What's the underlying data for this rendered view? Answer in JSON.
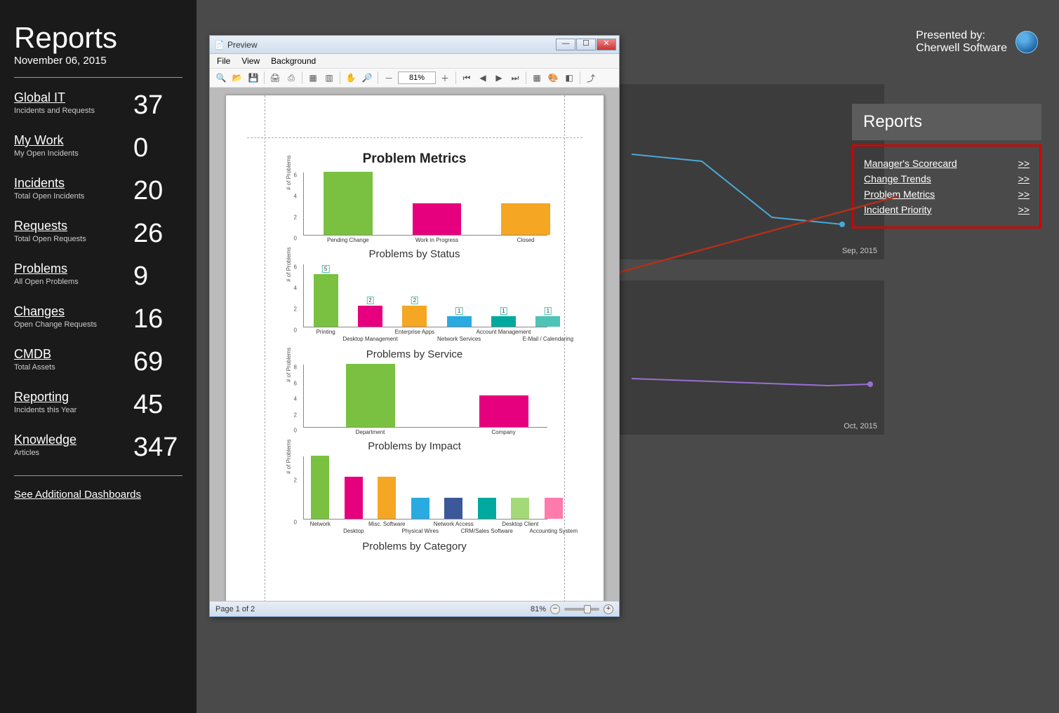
{
  "sidebar": {
    "title": "Reports",
    "date": "November 06, 2015",
    "items": [
      {
        "label": "Global IT",
        "sub": "Incidents and Requests",
        "value": "37"
      },
      {
        "label": "My Work",
        "sub": "My Open Incidents",
        "value": "0"
      },
      {
        "label": "Incidents",
        "sub": "Total Open Incidents",
        "value": "20"
      },
      {
        "label": "Requests",
        "sub": "Total Open Requests",
        "value": "26"
      },
      {
        "label": "Problems",
        "sub": "All Open Problems",
        "value": "9"
      },
      {
        "label": "Changes",
        "sub": "Open Change Requests",
        "value": "16"
      },
      {
        "label": "CMDB",
        "sub": "Total Assets",
        "value": "69"
      },
      {
        "label": "Reporting",
        "sub": "Incidents this Year",
        "value": "45"
      },
      {
        "label": "Knowledge",
        "sub": "Articles",
        "value": "347"
      }
    ],
    "additional": "See Additional Dashboards"
  },
  "presented": {
    "small": "Presented by:",
    "brand": "Cherwell Software"
  },
  "reports_panel": {
    "header": "Reports",
    "links": [
      {
        "label": "Manager's Scorecard",
        "arrow": ">>"
      },
      {
        "label": "Change Trends",
        "arrow": ">>"
      },
      {
        "label": "Problem Metrics",
        "arrow": ">>"
      },
      {
        "label": "Incident Priority",
        "arrow": ">>"
      }
    ]
  },
  "bg_dates": {
    "top": "Sep, 2015",
    "bottom": "Oct, 2015"
  },
  "preview": {
    "title": "Preview",
    "menu": {
      "file": "File",
      "view": "View",
      "background": "Background"
    },
    "zoom_toolbar": "81%",
    "status_page": "Page 1 of 2",
    "status_zoom": "81%",
    "report_title": "Problem Metrics",
    "ylabel": "# of Problems",
    "charts": {
      "status": "Problems by Status",
      "service": "Problems by Service",
      "impact": "Problems by Impact",
      "category": "Problems by Category"
    }
  },
  "chart_data": [
    {
      "type": "bar",
      "title": "Problems by Status",
      "ylabel": "# of Problems",
      "ylim": [
        0,
        6
      ],
      "categories": [
        "Pending Change",
        "Work in Progress",
        "Closed"
      ],
      "values": [
        6,
        3,
        3
      ],
      "colors": [
        "#7ac142",
        "#e6007e",
        "#f5a623"
      ]
    },
    {
      "type": "bar",
      "title": "Problems by Service",
      "ylabel": "# of Problems",
      "ylim": [
        0,
        6
      ],
      "categories": [
        "Printing",
        "Desktop Management",
        "Enterprise Apps",
        "Network Services",
        "Account Management",
        "E-Mail / Calendaring"
      ],
      "values": [
        5,
        2,
        2,
        1,
        1,
        1
      ],
      "colors": [
        "#7ac142",
        "#e6007e",
        "#f5a623",
        "#29abe2",
        "#00a99d",
        "#4fc3b5"
      ]
    },
    {
      "type": "bar",
      "title": "Problems by Impact",
      "ylabel": "# of Problems",
      "ylim": [
        0,
        8
      ],
      "categories": [
        "Department",
        "Company"
      ],
      "values": [
        8,
        4
      ],
      "colors": [
        "#7ac142",
        "#e6007e"
      ]
    },
    {
      "type": "bar",
      "title": "Problems by Category",
      "ylabel": "# of Problems",
      "ylim": [
        0,
        3
      ],
      "categories": [
        "Network",
        "Desktop",
        "Misc. Software",
        "Physical Wires",
        "Network Access",
        "CRM/Sales Software",
        "Desktop Client",
        "Accounting System"
      ],
      "values": [
        3,
        2,
        2,
        1,
        1,
        1,
        1,
        1
      ],
      "colors": [
        "#7ac142",
        "#e6007e",
        "#f5a623",
        "#29abe2",
        "#3b5998",
        "#00a99d",
        "#a3d977",
        "#ff7bac"
      ]
    }
  ]
}
